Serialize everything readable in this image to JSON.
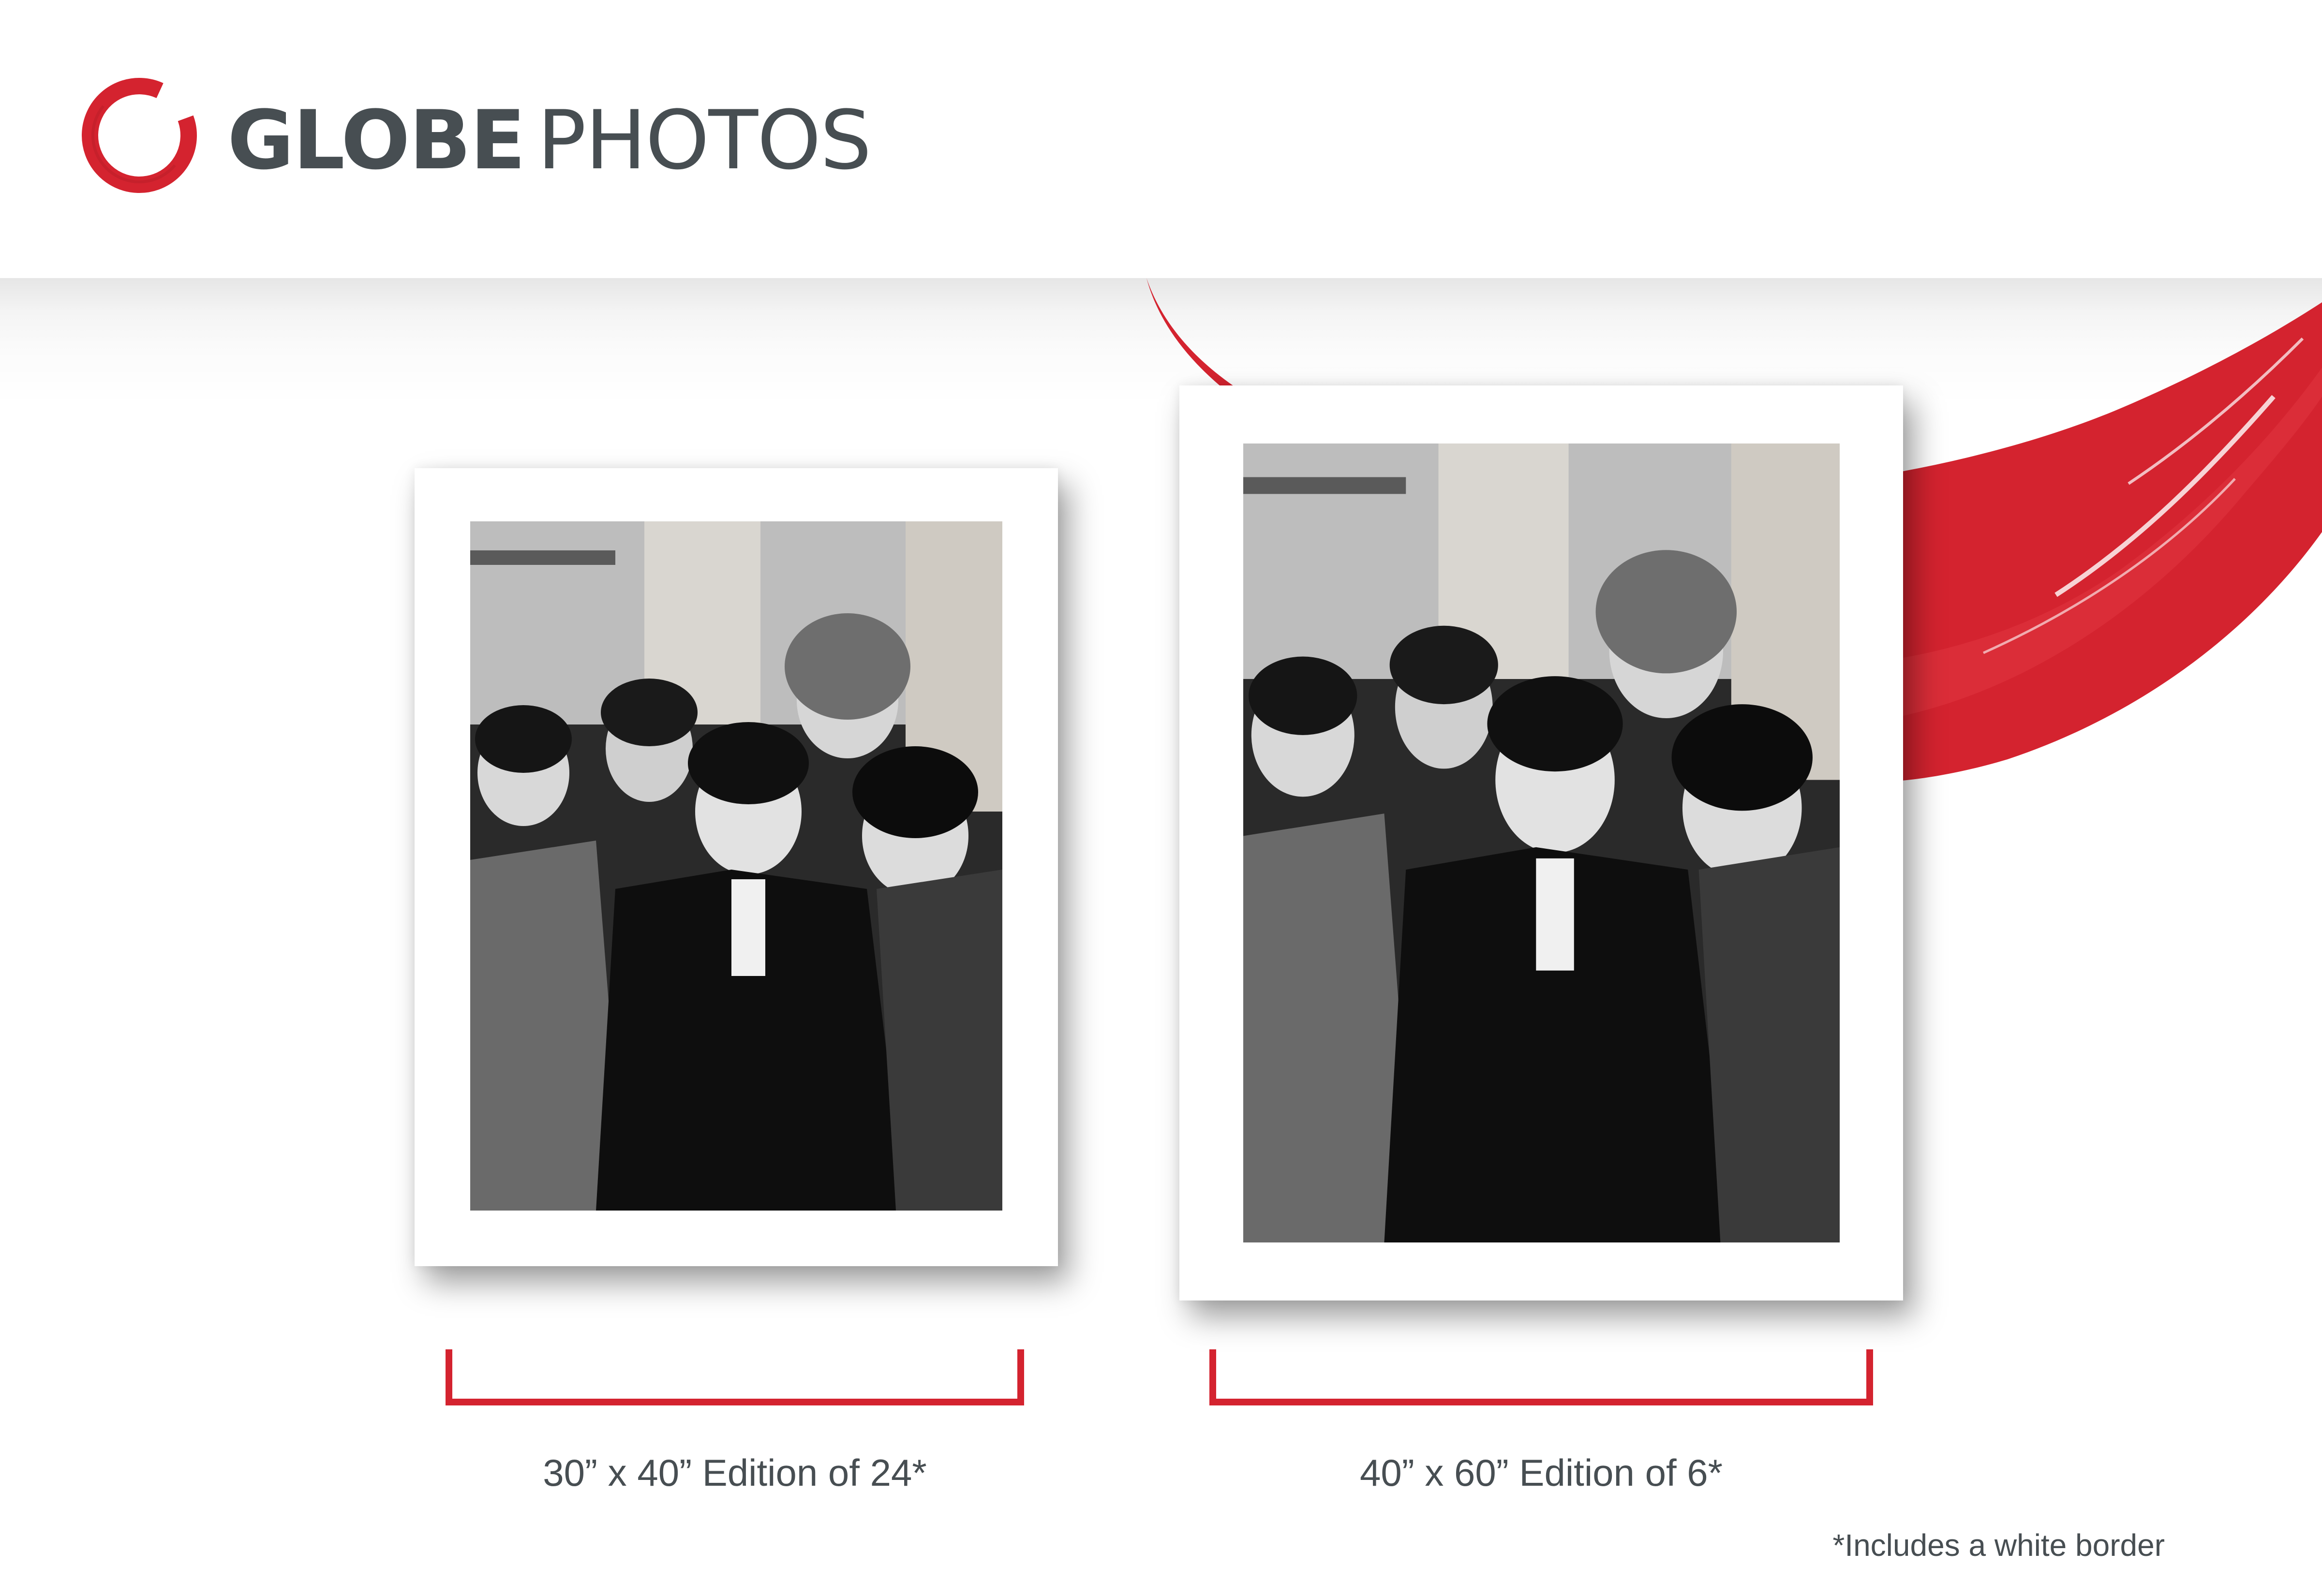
{
  "brand": {
    "logo_word_bold": "GLOBE",
    "logo_word_light": "PHOTOS",
    "accent_color": "#d4232f",
    "text_color": "#474e52"
  },
  "prints": [
    {
      "caption": "30” x 40” Edition of 24*"
    },
    {
      "caption": "40” x 60” Edition of 6*"
    }
  ],
  "footnote": "*Includes a white border"
}
